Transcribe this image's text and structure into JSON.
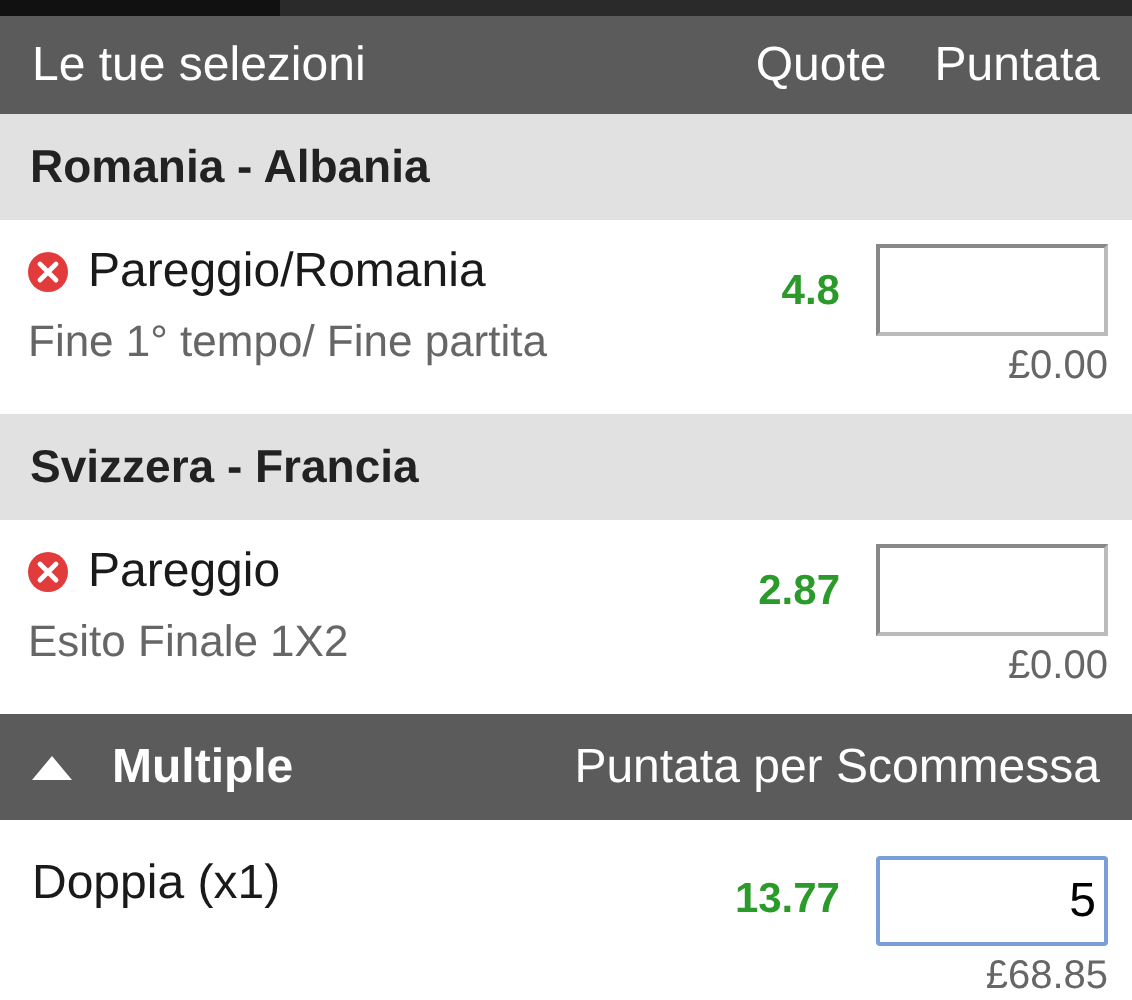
{
  "header": {
    "title": "Le tue selezioni",
    "odds_label": "Quote",
    "stake_label": "Puntata"
  },
  "events": [
    {
      "match": "Romania - Albania",
      "selection": "Pareggio/Romania",
      "market": "Fine 1° tempo/ Fine partita",
      "odds": "4.8",
      "returns": "£0.00",
      "focused": false
    },
    {
      "match": "Svizzera - Francia",
      "selection": "Pareggio",
      "market": "Esito Finale 1X2",
      "odds": "2.87",
      "returns": "£0.00",
      "focused": false
    }
  ],
  "multiples": {
    "title": "Multiple",
    "stake_label": "Puntata per Scommessa",
    "expanded": true,
    "bets": [
      {
        "name": "Doppia (x1)",
        "odds": "13.77",
        "stake": "5",
        "returns": "£68.85",
        "focused": true
      }
    ]
  }
}
